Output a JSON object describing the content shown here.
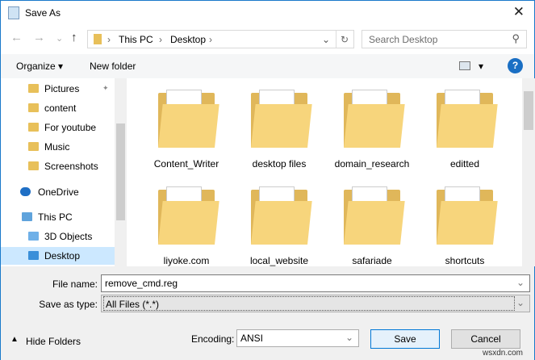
{
  "window": {
    "title": "Save As",
    "close": "✕"
  },
  "nav": {
    "back": "←",
    "forward": "→",
    "recent": "⌄",
    "up": "↑"
  },
  "address": {
    "segments": [
      "This PC",
      "Desktop"
    ],
    "sep": "›",
    "dropdown": "⌄",
    "refresh": "↻"
  },
  "search": {
    "placeholder": "Search Desktop",
    "icon": "⚲"
  },
  "toolbar": {
    "organize": "Organize ▾",
    "new_folder": "New folder",
    "view": "▾",
    "help": "?"
  },
  "sidebar": {
    "items": [
      {
        "label": "Pictures",
        "pin": "📌"
      },
      {
        "label": "content"
      },
      {
        "label": "For youtube"
      },
      {
        "label": "Music"
      },
      {
        "label": "Screenshots"
      },
      {
        "label": "OneDrive"
      },
      {
        "label": "This PC"
      },
      {
        "label": "3D Objects"
      },
      {
        "label": "Desktop",
        "selected": true
      }
    ]
  },
  "files": [
    "Content_Writer",
    "desktop files",
    "domain_research",
    "editted",
    "liyoke.com",
    "local_website",
    "safariade",
    "shortcuts"
  ],
  "form": {
    "file_name_label": "File name:",
    "file_name": "remove_cmd.reg",
    "type_label": "Save as type:",
    "type": "All Files  (*.*)",
    "encoding_label": "Encoding:",
    "encoding": "ANSI"
  },
  "buttons": {
    "hide_folders": "Hide Folders",
    "save": "Save",
    "cancel": "Cancel"
  },
  "watermark": "wsxdn.com"
}
